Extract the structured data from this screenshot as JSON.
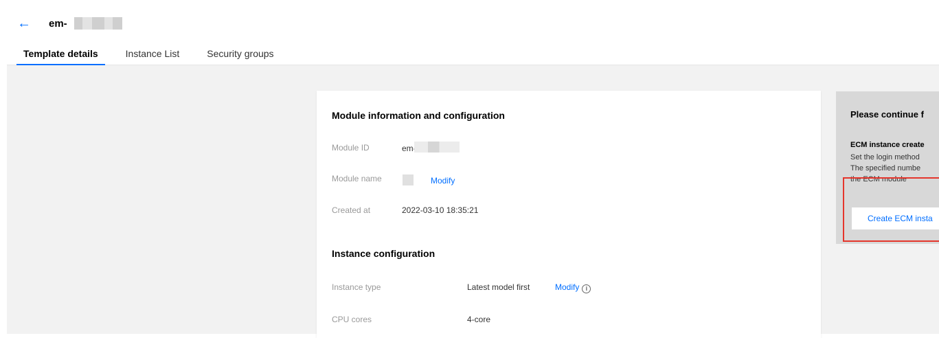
{
  "header": {
    "back_icon": "arrow-left-icon",
    "title": "em-"
  },
  "tabs": [
    {
      "label": "Template details",
      "active": true
    },
    {
      "label": "Instance List",
      "active": false
    },
    {
      "label": "Security groups",
      "active": false
    }
  ],
  "module_section": {
    "title": "Module information and configuration",
    "module_id_label": "Module ID",
    "module_id_value": "em-",
    "module_name_label": "Module name",
    "module_name_modify": "Modify",
    "created_at_label": "Created at",
    "created_at_value": "2022-03-10 18:35:21"
  },
  "instance_section": {
    "title": "Instance configuration",
    "instance_type_label": "Instance type",
    "instance_type_value": "Latest model first",
    "instance_type_modify": "Modify",
    "info_icon": "info-circle-icon",
    "cpu_label": "CPU cores",
    "cpu_value": "4-core"
  },
  "side_panel": {
    "title": "Please continue f",
    "subtitle": "ECM instance create",
    "line1": "Set the login method",
    "line2": "The specified numbe",
    "line3": "the ECM module",
    "button_label": "Create ECM insta"
  },
  "colors": {
    "accent": "#006eff",
    "highlight_border": "#e5352b",
    "page_bg": "#f2f2f2"
  }
}
